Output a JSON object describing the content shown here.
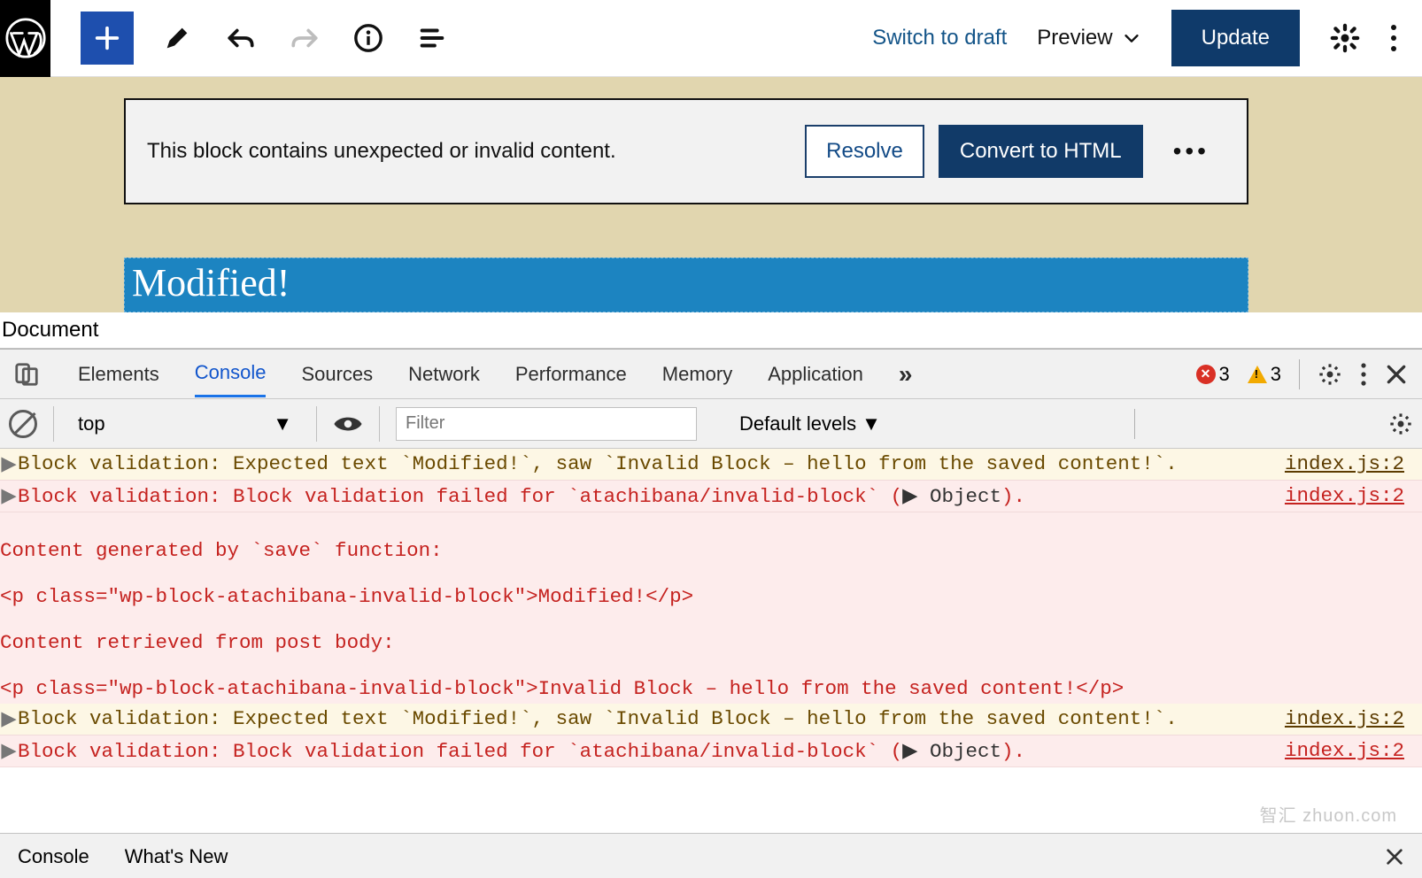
{
  "wp": {
    "switch_to_draft": "Switch to draft",
    "preview": "Preview",
    "update": "Update",
    "warning": {
      "text": "This block contains unexpected or invalid content.",
      "resolve": "Resolve",
      "convert": "Convert to HTML"
    },
    "block_text": "Modified!",
    "doc_label": "Document"
  },
  "devtools": {
    "tabs": {
      "elements": "Elements",
      "console": "Console",
      "sources": "Sources",
      "network": "Network",
      "performance": "Performance",
      "memory": "Memory",
      "application": "Application"
    },
    "error_count": "3",
    "warning_count": "3",
    "context": "top",
    "context_arrow": "▼",
    "filter_placeholder": "Filter",
    "levels": "Default levels ▼",
    "console_rows": [
      {
        "type": "warn",
        "arrow": "▶",
        "text": "Block validation: Expected text `Modified!`, saw `Invalid Block – hello from the saved content!`.",
        "src": "index.js:2"
      },
      {
        "type": "err",
        "arrow": "▶",
        "text": "Block validation: Block validation failed for `atachibana/invalid-block` (",
        "obj": "Object",
        "tail": ").",
        "src": "index.js:2"
      },
      {
        "type": "block",
        "lines": [
          "",
          "Content generated by `save` function:",
          "",
          "<p class=\"wp-block-atachibana-invalid-block\">Modified!</p>",
          "",
          "Content retrieved from post body:",
          "",
          "<p class=\"wp-block-atachibana-invalid-block\">Invalid Block – hello from the saved content!</p>"
        ]
      },
      {
        "type": "warn",
        "arrow": "▶",
        "text": "Block validation: Expected text `Modified!`, saw `Invalid Block – hello from the saved content!`.",
        "src": "index.js:2"
      },
      {
        "type": "err",
        "arrow": "▶",
        "text": "Block validation: Block validation failed for `atachibana/invalid-block` (",
        "obj": "Object",
        "tail": ").",
        "src": "index.js:2"
      }
    ],
    "drawer": {
      "console": "Console",
      "whatsnew": "What's New"
    }
  },
  "watermark": "智汇 zhuon.com"
}
